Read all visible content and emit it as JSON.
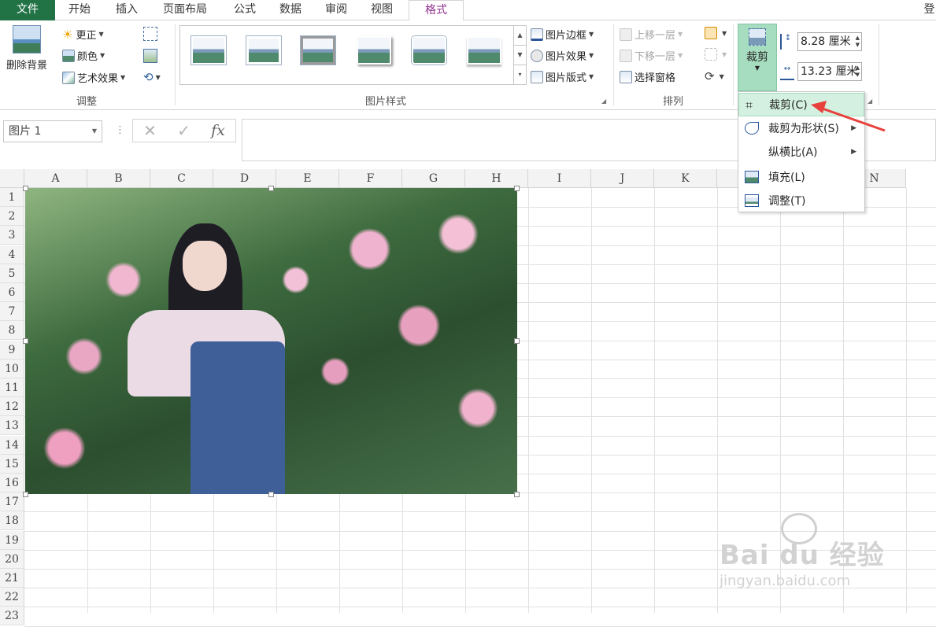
{
  "tabs": {
    "file": "文件",
    "items": [
      "开始",
      "插入",
      "页面布局",
      "公式",
      "数据",
      "审阅",
      "视图"
    ],
    "active": "格式",
    "right_partial": "登"
  },
  "ribbon": {
    "adjust": {
      "remove_bg": "删除背景",
      "correct": "更正",
      "color": "颜色",
      "artistic": "艺术效果",
      "group_label": "调整"
    },
    "styles": {
      "border": "图片边框",
      "effects": "图片效果",
      "layout": "图片版式",
      "group_label": "图片样式"
    },
    "arrange": {
      "bring_forward": "上移一层",
      "send_backward": "下移一层",
      "selection_pane": "选择窗格",
      "group_label": "排列"
    },
    "size": {
      "crop": "裁剪",
      "height": "8.28 厘米",
      "width": "13.23 厘米"
    }
  },
  "formula_bar": {
    "name_box": "图片 1",
    "fx": "fx",
    "value": ""
  },
  "grid": {
    "columns": [
      "A",
      "B",
      "C",
      "D",
      "E",
      "F",
      "G",
      "H",
      "I",
      "J",
      "K",
      "L",
      "M",
      "N"
    ],
    "rows": [
      "1",
      "2",
      "3",
      "4",
      "5",
      "6",
      "7",
      "8",
      "9",
      "10",
      "11",
      "12",
      "13",
      "14",
      "15",
      "16",
      "17",
      "18",
      "19",
      "20",
      "21",
      "22",
      "23"
    ]
  },
  "crop_menu": {
    "items": [
      {
        "label": "裁剪(C)",
        "underline": "C",
        "highlighted": true
      },
      {
        "label": "裁剪为形状(S)",
        "underline": "S",
        "submenu": true
      },
      {
        "label": "纵横比(A)",
        "underline": "A",
        "submenu": true
      },
      {
        "label": "填充(L)",
        "underline": "L"
      },
      {
        "label": "调整(T)",
        "underline": "T"
      }
    ]
  },
  "watermark": {
    "brand": "Bai du 经验",
    "url": "jingyan.baidu.com"
  },
  "colors": {
    "excel_green": "#217346",
    "format_tab": "#8f2f8f",
    "crop_active": "#a6dcbf",
    "menu_highlight": "#d3f0e0",
    "annotation_arrow": "#e8413c"
  }
}
